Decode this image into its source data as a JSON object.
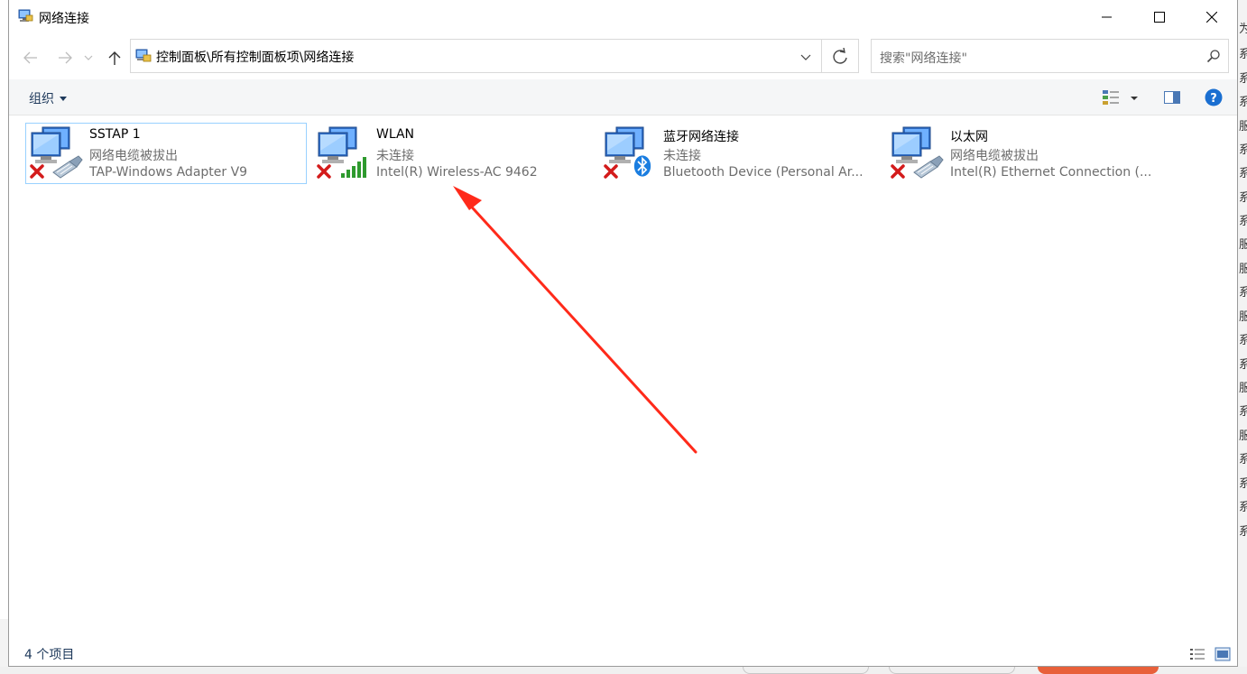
{
  "window": {
    "title": "网络连接"
  },
  "address_bar": {
    "path": "控制面板\\所有控制面板项\\网络连接"
  },
  "search": {
    "placeholder": "搜索\"网络连接\""
  },
  "command_bar": {
    "organize_label": "组织"
  },
  "connections": [
    {
      "name": "SSTAP 1",
      "status": "网络电缆被拔出",
      "device": "TAP-Windows Adapter V9",
      "adapter_icon": "ethernet-cable-icon",
      "selected": true
    },
    {
      "name": "WLAN",
      "status": "未连接",
      "device": "Intel(R) Wireless-AC 9462",
      "adapter_icon": "wifi-signal-icon",
      "selected": false
    },
    {
      "name": "蓝牙网络连接",
      "status": "未连接",
      "device": "Bluetooth Device (Personal Ar...",
      "adapter_icon": "bluetooth-icon",
      "selected": false
    },
    {
      "name": "以太网",
      "status": "网络电缆被拔出",
      "device": "Intel(R) Ethernet Connection (...",
      "adapter_icon": "ethernet-cable-icon",
      "selected": false
    }
  ],
  "status_bar": {
    "item_count": "4 个项目"
  },
  "background": {
    "right_edge_chars": [
      "为",
      "系",
      "系",
      "系",
      "服",
      "系",
      "系",
      "系",
      "系",
      "服",
      "服",
      "系",
      "服",
      "系",
      "系",
      "服",
      "系",
      "服",
      "系",
      "系",
      "系",
      "系"
    ]
  },
  "colors": {
    "accent": "#1e395b",
    "selection_border": "#99d1ff",
    "annotation_arrow": "#ff2a1a",
    "help_blue": "#1a6fd1"
  }
}
